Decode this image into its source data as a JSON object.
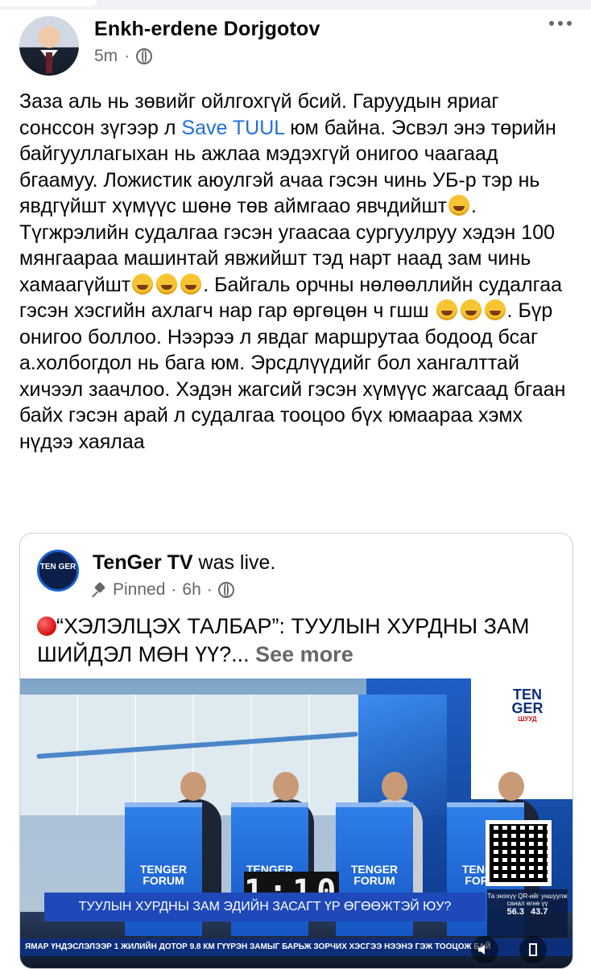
{
  "post": {
    "author": "Enkh-erdene Dorjgotov",
    "time": "5m",
    "text_parts": [
      "Заза аль нь зөвийг ойлгохгүй бсий. Гаруудын яриаг сонссон зүгээр л ",
      "Save TUUL",
      " юм байна. Эсвэл энэ төрийн байгууллагыхан нь ажлаа мэдэхгүй онигоо чаагаад бгаамуу. Ложистик аюулгэй ачаа гэсэн чинь УБ-р тэр нь явдгүйшт хүмүүс шөнө төв аймгаао явчдийшт",
      ". Түгжрэлийн судалгаа гэсэн угаасаа сургуулруу хэдэн 100 мянгаараа машинтай явжийшт тэд нарт наад зам чинь хамаагүйшт",
      ". Байгаль орчны нөлөөллийн судалгаа гэсэн хэсгийн ахлагч нар гар өргөцөн ч гшш ",
      ". Бүр онигоо боллоо. Нээрээ л явдаг маршрутаа бодоод бсаг а.холбогдол нь бага юм. Эрсдлүүдийг бол хангалттай хичээл заачлоо. Хэдэн жагсий гэсэн хүмүүс жагсаад бгаан байх гэсэн арай л судалгаа тооцоо бүх юмаараа хэмх нүдээ хаялаа"
    ],
    "link_color": "#216fdb"
  },
  "shared": {
    "logo_text": "TEN GER",
    "page_name": "TenGer TV",
    "action": " was live.",
    "pinned": "Pinned",
    "time": "6h",
    "headline": "“ХЭЛЭЛЦЭХ ТАЛБАР”: ТУУЛЫН ХУРДНЫ ЗАМ ШИЙДЭЛ МӨН ҮҮ?...",
    "see_more": "See more"
  },
  "video": {
    "channel_logo": "TEN GER",
    "channel_sub": "ШУУД",
    "podium_label": "TENGER FORUM",
    "clock": "1:10",
    "caption": "ТУУЛЫН ХУРДНЫ ЗАМ ЭДИЙН ЗАСАГТ ҮР ӨГӨӨЖТЭЙ ЮУ?",
    "ticker": "ЯМАР ҮНДЭСЛЭЛЭЭР 1 ЖИЛИЙН ДОТОР 9.8 КМ ГҮҮРЭН ЗАМЫГ БАРЬЖ ЗОРЧИХ ХЭСГЭЭ НЭЭНЭ ГЭЖ ТООЦОЖ БАЙ",
    "poll_title": "Та энэхүү QR-ийг уншуулж санал өгнө үү",
    "poll_a": "56.3",
    "poll_b": "43.7"
  }
}
